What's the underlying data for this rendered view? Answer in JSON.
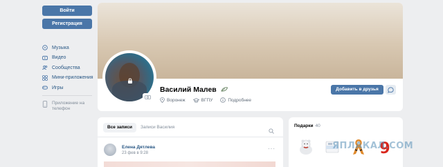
{
  "sidebar": {
    "login_label": "Войти",
    "register_label": "Регистрация",
    "items": [
      {
        "label": "Музыка",
        "icon": "music-icon"
      },
      {
        "label": "Видео",
        "icon": "video-icon"
      },
      {
        "label": "Сообщества",
        "icon": "groups-icon"
      },
      {
        "label": "Мини-приложения",
        "icon": "apps-icon"
      },
      {
        "label": "Игры",
        "icon": "games-icon"
      }
    ],
    "app_promo": "Приложение на телефон"
  },
  "profile": {
    "name": "Василий Малев",
    "city": "Воронеж",
    "university": "ВГПУ",
    "details_label": "Подробнее",
    "add_friend_label": "Добавить в друзья"
  },
  "wall": {
    "tab_all": "Все записи",
    "tab_own": "Записи Василия",
    "post": {
      "author": "Елена Дятлева",
      "date": "23 фев в 9:28",
      "more": "···"
    }
  },
  "gifts": {
    "title": "Подарки",
    "count": "40"
  },
  "watermark": "ЯПЛАКАЛ.COM",
  "colors": {
    "accent": "#4a76a8",
    "link": "#2a5885",
    "background": "#edeef0"
  }
}
